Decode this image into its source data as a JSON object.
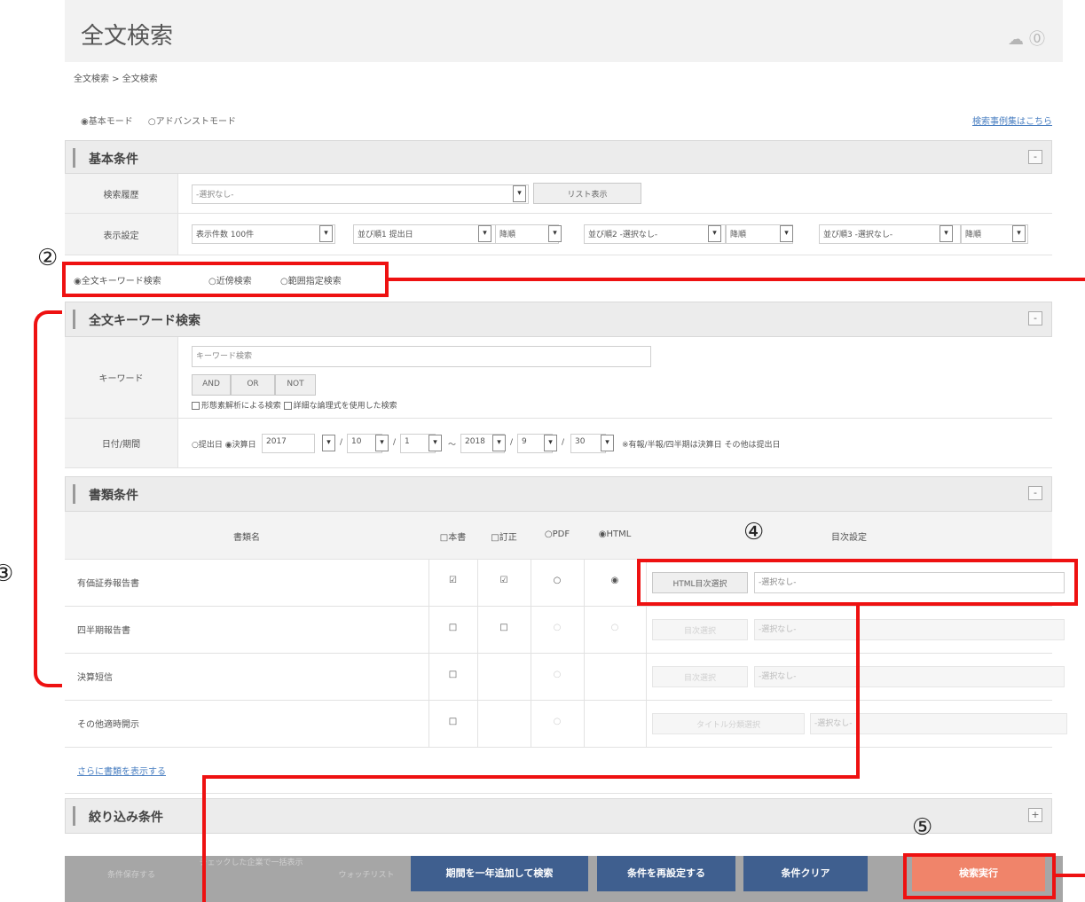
{
  "header": {
    "title": "全文検索",
    "icons": [
      "help-hat-icon",
      "question-icon"
    ]
  },
  "breadcrumb": "全文検索 > 全文検索",
  "modes": {
    "basic": "◉基本モード",
    "advanced": "○アドバンストモード",
    "help_link": "検索事例集はこちら"
  },
  "basic": {
    "title": "基本条件",
    "toggle": "-",
    "history_label": "検索履歴",
    "history_value": "-選択なし-",
    "list_button": "リスト表示",
    "display_label": "表示設定",
    "display_count_label": "表示件数",
    "display_count_value": "100件",
    "sort1_label": "並び順1",
    "sort1_value": "提出日",
    "sort1_order": "降順",
    "sort2_label": "並び順2",
    "sort2_value": "-選択なし-",
    "sort2_order": "降順",
    "sort3_label": "並び順3",
    "sort3_value": "-選択なし-",
    "sort3_order": "降順"
  },
  "search_types": {
    "fulltext": "◉全文キーワード検索",
    "near": "○近傍検索",
    "range": "○範囲指定検索"
  },
  "keyword": {
    "title": "全文キーワード検索",
    "toggle": "-",
    "label": "キーワード",
    "placeholder": "キーワード検索",
    "and": "AND",
    "or": "OR",
    "not": "NOT",
    "opt1": "形態素解析による検索",
    "opt2": "詳細な論理式を使用した検索",
    "date_label": "日付/期間",
    "date_sub": "○提出日 ◉決算日",
    "from_y": "2017",
    "from_m": "10",
    "from_d": "1",
    "to_y": "2018",
    "to_m": "9",
    "to_d": "30",
    "note": "※有報/半報/四半期は決算日 その他は提出日"
  },
  "docs": {
    "title": "書類条件",
    "toggle": "-",
    "col_name": "書類名",
    "col_main": "□本書",
    "col_amend": "□訂正",
    "col_pdf": "○PDF",
    "col_html": "◉HTML",
    "col_toc": "目次設定",
    "rows": [
      {
        "name": "有価証券報告書",
        "main": "☑",
        "amend": "☑",
        "pdf": "○",
        "html": "◉",
        "btn": "HTML目次選択",
        "sel": "-選択なし-"
      },
      {
        "name": "四半期報告書",
        "main": "□",
        "amend": "□",
        "pdf": "○",
        "html": "○",
        "btn": "目次選択",
        "sel": "-選択なし-"
      },
      {
        "name": "決算短信",
        "main": "□",
        "amend": "",
        "pdf": "○",
        "html": "",
        "btn": "目次選択",
        "sel": "-選択なし-"
      },
      {
        "name": "その他適時開示",
        "main": "□",
        "amend": "",
        "pdf": "○",
        "html": "",
        "btn": "タイトル分類選択",
        "sel": "-選択なし-"
      }
    ],
    "more_link": "さらに書類を表示する"
  },
  "filter": {
    "title": "絞り込み条件",
    "toggle": "+"
  },
  "footer": {
    "dim1": "条件保存する",
    "dim2": "チェックした企業で一括表示",
    "dim3": "ウォッチリスト",
    "add_year": "期間を一年追加して検索",
    "reset": "条件を再設定する",
    "clear": "条件クリア",
    "execute": "検索実行"
  },
  "annotations": {
    "n2": "②",
    "n3": "③",
    "n4": "④",
    "n5": "⑤"
  },
  "colors": {
    "accent_red": "#ee1111",
    "footer_btn": "#3f5f8f",
    "execute_btn": "#f0846a"
  }
}
